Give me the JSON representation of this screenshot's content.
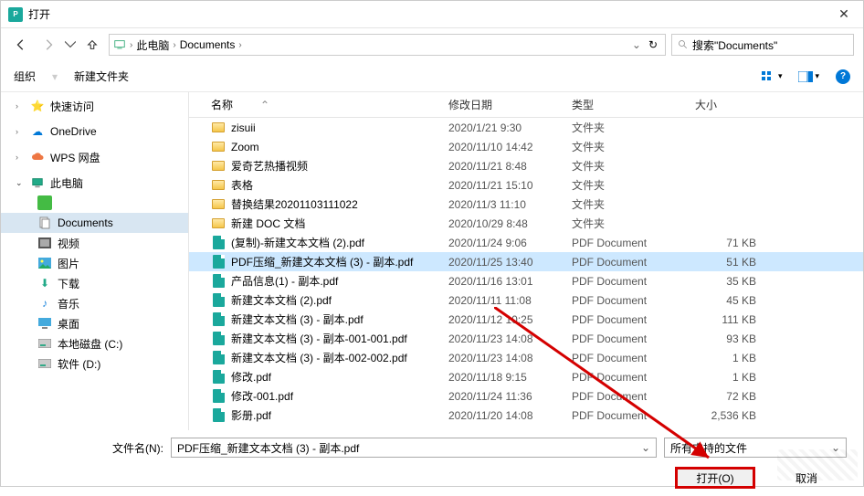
{
  "title": "打开",
  "breadcrumb": {
    "pc": "此电脑",
    "folder": "Documents"
  },
  "search_placeholder": "搜索\"Documents\"",
  "toolbar": {
    "organize": "组织",
    "newfolder": "新建文件夹"
  },
  "columns": {
    "name": "名称",
    "date": "修改日期",
    "type": "类型",
    "size": "大小"
  },
  "sidebar": {
    "quick": "快速访问",
    "onedrive": "OneDrive",
    "wps": "WPS 网盘",
    "pc": "此电脑",
    "documents": "Documents",
    "video": "视频",
    "pictures": "图片",
    "downloads": "下载",
    "music": "音乐",
    "desktop": "桌面",
    "diskc": "本地磁盘 (C:)",
    "diskd": "软件 (D:)"
  },
  "files": [
    {
      "icon": "folder",
      "name": "zisuii",
      "date": "2020/1/21 9:30",
      "type": "文件夹",
      "size": ""
    },
    {
      "icon": "folder",
      "name": "Zoom",
      "date": "2020/11/10 14:42",
      "type": "文件夹",
      "size": ""
    },
    {
      "icon": "folder",
      "name": "爱奇艺热播视频",
      "date": "2020/11/21 8:48",
      "type": "文件夹",
      "size": ""
    },
    {
      "icon": "folder",
      "name": "表格",
      "date": "2020/11/21 15:10",
      "type": "文件夹",
      "size": ""
    },
    {
      "icon": "folder",
      "name": "替换结果20201103111022",
      "date": "2020/11/3 11:10",
      "type": "文件夹",
      "size": ""
    },
    {
      "icon": "folder",
      "name": "新建 DOC 文档",
      "date": "2020/10/29 8:48",
      "type": "文件夹",
      "size": ""
    },
    {
      "icon": "pdf",
      "name": "(复制)-新建文本文档 (2).pdf",
      "date": "2020/11/24 9:06",
      "type": "PDF Document",
      "size": "71 KB"
    },
    {
      "icon": "pdf",
      "name": "PDF压缩_新建文本文档 (3) - 副本.pdf",
      "date": "2020/11/25 13:40",
      "type": "PDF Document",
      "size": "51 KB",
      "sel": true
    },
    {
      "icon": "pdf",
      "name": "产品信息(1) - 副本.pdf",
      "date": "2020/11/16 13:01",
      "type": "PDF Document",
      "size": "35 KB"
    },
    {
      "icon": "pdf",
      "name": "新建文本文档 (2).pdf",
      "date": "2020/11/11 11:08",
      "type": "PDF Document",
      "size": "45 KB"
    },
    {
      "icon": "pdf",
      "name": "新建文本文档 (3) - 副本.pdf",
      "date": "2020/11/12 10:25",
      "type": "PDF Document",
      "size": "111 KB"
    },
    {
      "icon": "pdf",
      "name": "新建文本文档 (3) - 副本-001-001.pdf",
      "date": "2020/11/23 14:08",
      "type": "PDF Document",
      "size": "93 KB"
    },
    {
      "icon": "pdf",
      "name": "新建文本文档 (3) - 副本-002-002.pdf",
      "date": "2020/11/23 14:08",
      "type": "PDF Document",
      "size": "1 KB"
    },
    {
      "icon": "pdf",
      "name": "修改.pdf",
      "date": "2020/11/18 9:15",
      "type": "PDF Document",
      "size": "1 KB"
    },
    {
      "icon": "pdf",
      "name": "修改-001.pdf",
      "date": "2020/11/24 11:36",
      "type": "PDF Document",
      "size": "72 KB"
    },
    {
      "icon": "pdf",
      "name": "影册.pdf",
      "date": "2020/11/20 14:08",
      "type": "PDF Document",
      "size": "2,536 KB"
    }
  ],
  "filename_label": "文件名(N):",
  "filename_value": "PDF压缩_新建文本文档 (3) - 副本.pdf",
  "filter": "所有支持的文件",
  "open_btn": "打开(O)",
  "cancel_btn": "取消"
}
